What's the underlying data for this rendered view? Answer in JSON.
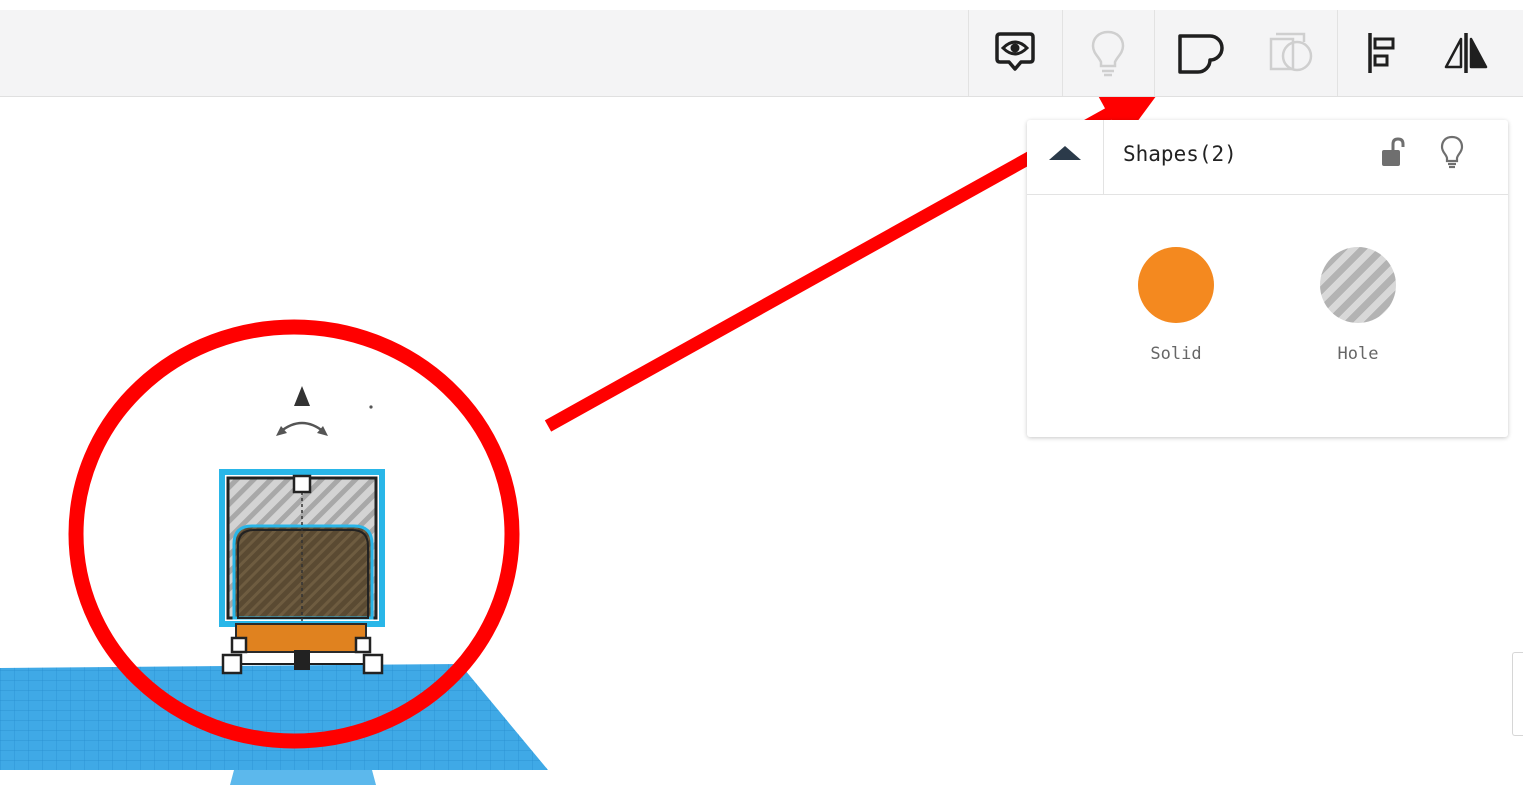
{
  "toolbar": {
    "buttons": [
      {
        "name": "show-notes-icon",
        "state": "enabled"
      },
      {
        "name": "lightbulb-icon",
        "state": "disabled"
      },
      {
        "name": "group-icon",
        "state": "enabled"
      },
      {
        "name": "ungroup-icon",
        "state": "disabled"
      },
      {
        "name": "align-icon",
        "state": "enabled"
      },
      {
        "name": "mirror-icon",
        "state": "enabled"
      }
    ]
  },
  "inspector": {
    "title": "Shapes(2)",
    "solid_label": "Solid",
    "hole_label": "Hole",
    "solid_color": "#f4891f",
    "hole_pattern": "gray-stripes"
  },
  "annotation": {
    "circle_color": "#ff0000",
    "arrow_color": "#ff0000"
  },
  "colors": {
    "workplane": "#3fa9e6",
    "selection_outline": "#29b6e8",
    "solid": "#f4891f"
  }
}
